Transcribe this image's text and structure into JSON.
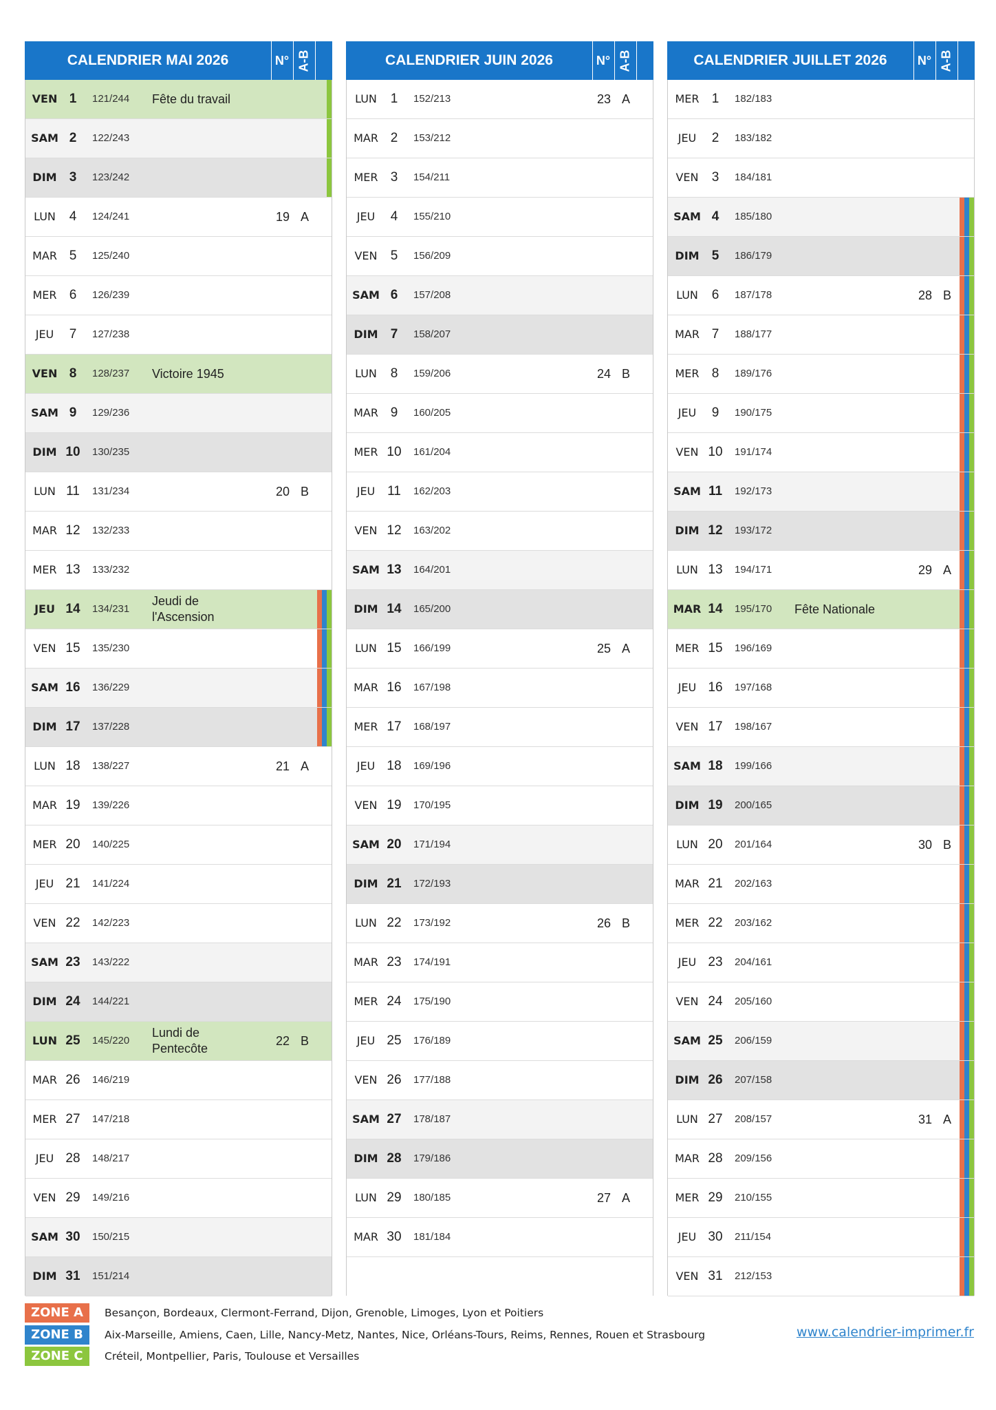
{
  "header": {
    "no_label": "N°",
    "ab_label": "A-B"
  },
  "colors": {
    "header": "#1976c9",
    "zone_a": "#e8704a",
    "zone_b": "#2f84cc",
    "zone_c": "#8cc63e",
    "holiday": "#d2e6bf"
  },
  "months": [
    {
      "title": "CALENDRIER MAI 2026",
      "days": [
        {
          "n": "VEN",
          "d": "1",
          "y": "121/244",
          "type": "hol",
          "event": "Fête du travail",
          "zones": "C"
        },
        {
          "n": "SAM",
          "d": "2",
          "y": "122/243",
          "type": "sat",
          "zones": "C"
        },
        {
          "n": "DIM",
          "d": "3",
          "y": "123/242",
          "type": "sun",
          "zones": "C"
        },
        {
          "n": "LUN",
          "d": "4",
          "y": "124/241",
          "wk": "19",
          "ab": "A"
        },
        {
          "n": "MAR",
          "d": "5",
          "y": "125/240"
        },
        {
          "n": "MER",
          "d": "6",
          "y": "126/239"
        },
        {
          "n": "JEU",
          "d": "7",
          "y": "127/238"
        },
        {
          "n": "VEN",
          "d": "8",
          "y": "128/237",
          "type": "hol",
          "event": "Victoire 1945"
        },
        {
          "n": "SAM",
          "d": "9",
          "y": "129/236",
          "type": "sat"
        },
        {
          "n": "DIM",
          "d": "10",
          "y": "130/235",
          "type": "sun"
        },
        {
          "n": "LUN",
          "d": "11",
          "y": "131/234",
          "wk": "20",
          "ab": "B"
        },
        {
          "n": "MAR",
          "d": "12",
          "y": "132/233"
        },
        {
          "n": "MER",
          "d": "13",
          "y": "133/232"
        },
        {
          "n": "JEU",
          "d": "14",
          "y": "134/231",
          "type": "hol",
          "event": "Jeudi de l'Ascension",
          "zones": "ABC"
        },
        {
          "n": "VEN",
          "d": "15",
          "y": "135/230",
          "zones": "ABC"
        },
        {
          "n": "SAM",
          "d": "16",
          "y": "136/229",
          "type": "sat",
          "zones": "ABC"
        },
        {
          "n": "DIM",
          "d": "17",
          "y": "137/228",
          "type": "sun",
          "zones": "ABC"
        },
        {
          "n": "LUN",
          "d": "18",
          "y": "138/227",
          "wk": "21",
          "ab": "A"
        },
        {
          "n": "MAR",
          "d": "19",
          "y": "139/226"
        },
        {
          "n": "MER",
          "d": "20",
          "y": "140/225"
        },
        {
          "n": "JEU",
          "d": "21",
          "y": "141/224"
        },
        {
          "n": "VEN",
          "d": "22",
          "y": "142/223"
        },
        {
          "n": "SAM",
          "d": "23",
          "y": "143/222",
          "type": "sat"
        },
        {
          "n": "DIM",
          "d": "24",
          "y": "144/221",
          "type": "sun"
        },
        {
          "n": "LUN",
          "d": "25",
          "y": "145/220",
          "type": "hol",
          "event": "Lundi de Pentecôte",
          "wk": "22",
          "ab": "B"
        },
        {
          "n": "MAR",
          "d": "26",
          "y": "146/219"
        },
        {
          "n": "MER",
          "d": "27",
          "y": "147/218"
        },
        {
          "n": "JEU",
          "d": "28",
          "y": "148/217"
        },
        {
          "n": "VEN",
          "d": "29",
          "y": "149/216"
        },
        {
          "n": "SAM",
          "d": "30",
          "y": "150/215",
          "type": "sat"
        },
        {
          "n": "DIM",
          "d": "31",
          "y": "151/214",
          "type": "sun"
        }
      ]
    },
    {
      "title": "CALENDRIER JUIN 2026",
      "days": [
        {
          "n": "LUN",
          "d": "1",
          "y": "152/213",
          "wk": "23",
          "ab": "A"
        },
        {
          "n": "MAR",
          "d": "2",
          "y": "153/212"
        },
        {
          "n": "MER",
          "d": "3",
          "y": "154/211"
        },
        {
          "n": "JEU",
          "d": "4",
          "y": "155/210"
        },
        {
          "n": "VEN",
          "d": "5",
          "y": "156/209"
        },
        {
          "n": "SAM",
          "d": "6",
          "y": "157/208",
          "type": "sat"
        },
        {
          "n": "DIM",
          "d": "7",
          "y": "158/207",
          "type": "sun"
        },
        {
          "n": "LUN",
          "d": "8",
          "y": "159/206",
          "wk": "24",
          "ab": "B"
        },
        {
          "n": "MAR",
          "d": "9",
          "y": "160/205"
        },
        {
          "n": "MER",
          "d": "10",
          "y": "161/204"
        },
        {
          "n": "JEU",
          "d": "11",
          "y": "162/203"
        },
        {
          "n": "VEN",
          "d": "12",
          "y": "163/202"
        },
        {
          "n": "SAM",
          "d": "13",
          "y": "164/201",
          "type": "sat"
        },
        {
          "n": "DIM",
          "d": "14",
          "y": "165/200",
          "type": "sun"
        },
        {
          "n": "LUN",
          "d": "15",
          "y": "166/199",
          "wk": "25",
          "ab": "A"
        },
        {
          "n": "MAR",
          "d": "16",
          "y": "167/198"
        },
        {
          "n": "MER",
          "d": "17",
          "y": "168/197"
        },
        {
          "n": "JEU",
          "d": "18",
          "y": "169/196"
        },
        {
          "n": "VEN",
          "d": "19",
          "y": "170/195"
        },
        {
          "n": "SAM",
          "d": "20",
          "y": "171/194",
          "type": "sat"
        },
        {
          "n": "DIM",
          "d": "21",
          "y": "172/193",
          "type": "sun"
        },
        {
          "n": "LUN",
          "d": "22",
          "y": "173/192",
          "wk": "26",
          "ab": "B"
        },
        {
          "n": "MAR",
          "d": "23",
          "y": "174/191"
        },
        {
          "n": "MER",
          "d": "24",
          "y": "175/190"
        },
        {
          "n": "JEU",
          "d": "25",
          "y": "176/189"
        },
        {
          "n": "VEN",
          "d": "26",
          "y": "177/188"
        },
        {
          "n": "SAM",
          "d": "27",
          "y": "178/187",
          "type": "sat"
        },
        {
          "n": "DIM",
          "d": "28",
          "y": "179/186",
          "type": "sun"
        },
        {
          "n": "LUN",
          "d": "29",
          "y": "180/185",
          "wk": "27",
          "ab": "A"
        },
        {
          "n": "MAR",
          "d": "30",
          "y": "181/184"
        }
      ]
    },
    {
      "title": "CALENDRIER JUILLET 2026",
      "days": [
        {
          "n": "MER",
          "d": "1",
          "y": "182/183"
        },
        {
          "n": "JEU",
          "d": "2",
          "y": "183/182"
        },
        {
          "n": "VEN",
          "d": "3",
          "y": "184/181"
        },
        {
          "n": "SAM",
          "d": "4",
          "y": "185/180",
          "type": "sat",
          "zones": "ABC"
        },
        {
          "n": "DIM",
          "d": "5",
          "y": "186/179",
          "type": "sun",
          "zones": "ABC"
        },
        {
          "n": "LUN",
          "d": "6",
          "y": "187/178",
          "wk": "28",
          "ab": "B",
          "zones": "ABC"
        },
        {
          "n": "MAR",
          "d": "7",
          "y": "188/177",
          "zones": "ABC"
        },
        {
          "n": "MER",
          "d": "8",
          "y": "189/176",
          "zones": "ABC"
        },
        {
          "n": "JEU",
          "d": "9",
          "y": "190/175",
          "zones": "ABC"
        },
        {
          "n": "VEN",
          "d": "10",
          "y": "191/174",
          "zones": "ABC"
        },
        {
          "n": "SAM",
          "d": "11",
          "y": "192/173",
          "type": "sat",
          "zones": "ABC"
        },
        {
          "n": "DIM",
          "d": "12",
          "y": "193/172",
          "type": "sun",
          "zones": "ABC"
        },
        {
          "n": "LUN",
          "d": "13",
          "y": "194/171",
          "wk": "29",
          "ab": "A",
          "zones": "ABC"
        },
        {
          "n": "MAR",
          "d": "14",
          "y": "195/170",
          "type": "hol",
          "event": "Fête Nationale",
          "zones": "ABC"
        },
        {
          "n": "MER",
          "d": "15",
          "y": "196/169",
          "zones": "ABC"
        },
        {
          "n": "JEU",
          "d": "16",
          "y": "197/168",
          "zones": "ABC"
        },
        {
          "n": "VEN",
          "d": "17",
          "y": "198/167",
          "zones": "ABC"
        },
        {
          "n": "SAM",
          "d": "18",
          "y": "199/166",
          "type": "sat",
          "zones": "ABC"
        },
        {
          "n": "DIM",
          "d": "19",
          "y": "200/165",
          "type": "sun",
          "zones": "ABC"
        },
        {
          "n": "LUN",
          "d": "20",
          "y": "201/164",
          "wk": "30",
          "ab": "B",
          "zones": "ABC"
        },
        {
          "n": "MAR",
          "d": "21",
          "y": "202/163",
          "zones": "ABC"
        },
        {
          "n": "MER",
          "d": "22",
          "y": "203/162",
          "zones": "ABC"
        },
        {
          "n": "JEU",
          "d": "23",
          "y": "204/161",
          "zones": "ABC"
        },
        {
          "n": "VEN",
          "d": "24",
          "y": "205/160",
          "zones": "ABC"
        },
        {
          "n": "SAM",
          "d": "25",
          "y": "206/159",
          "type": "sat",
          "zones": "ABC"
        },
        {
          "n": "DIM",
          "d": "26",
          "y": "207/158",
          "type": "sun",
          "zones": "ABC"
        },
        {
          "n": "LUN",
          "d": "27",
          "y": "208/157",
          "wk": "31",
          "ab": "A",
          "zones": "ABC"
        },
        {
          "n": "MAR",
          "d": "28",
          "y": "209/156",
          "zones": "ABC"
        },
        {
          "n": "MER",
          "d": "29",
          "y": "210/155",
          "zones": "ABC"
        },
        {
          "n": "JEU",
          "d": "30",
          "y": "211/154",
          "zones": "ABC"
        },
        {
          "n": "VEN",
          "d": "31",
          "y": "212/153",
          "zones": "ABC"
        }
      ]
    }
  ],
  "legend": [
    {
      "label": "ZONE A",
      "text": "Besançon, Bordeaux, Clermont-Ferrand, Dijon, Grenoble, Limoges, Lyon et Poitiers",
      "color": "#e8704a"
    },
    {
      "label": "ZONE B",
      "text": "Aix-Marseille, Amiens, Caen, Lille, Nancy-Metz, Nantes, Nice, Orléans-Tours, Reims, Rennes, Rouen et Strasbourg",
      "color": "#2f84cc"
    },
    {
      "label": "ZONE C",
      "text": "Créteil, Montpellier, Paris, Toulouse et Versailles",
      "color": "#8cc63e"
    }
  ],
  "website": "www.calendrier-imprimer.fr"
}
